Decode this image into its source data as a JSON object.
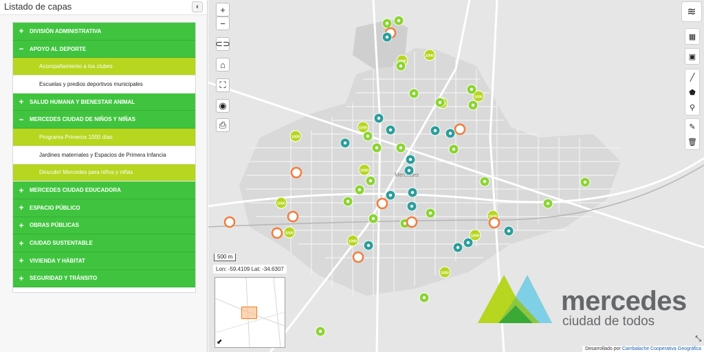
{
  "panel": {
    "title": "Listado de capas",
    "collapse_icon": "chevron-left-icon",
    "items": [
      {
        "kind": "group",
        "sign": "+",
        "label": "DIVISIÓN ADMINISTRATIVA"
      },
      {
        "kind": "group",
        "sign": "−",
        "label": "APOYO AL DEPORTE"
      },
      {
        "kind": "sub",
        "active": true,
        "label": "Acompañamiento a los clubes"
      },
      {
        "kind": "sub",
        "active": false,
        "label": "Escuelas y predios deportivos municipales"
      },
      {
        "kind": "group",
        "sign": "+",
        "label": "SALUD HUMANA Y BIENESTAR ANIMAL"
      },
      {
        "kind": "group",
        "sign": "−",
        "label": "MERCEDES CIUDAD DE NIÑOS Y NIÑAS"
      },
      {
        "kind": "sub",
        "active": true,
        "label": "Programa Primeros 1000 días"
      },
      {
        "kind": "sub",
        "active": false,
        "label": "Jardines maternales y Espacios de Primera Infancia"
      },
      {
        "kind": "sub",
        "active": true,
        "label": "Descubrí Mercedes para niños y niñas"
      },
      {
        "kind": "group",
        "sign": "+",
        "label": "MERCEDES CIUDAD EDUCADORA"
      },
      {
        "kind": "group",
        "sign": "+",
        "label": "ESPACIO PÚBLICO"
      },
      {
        "kind": "group",
        "sign": "+",
        "label": "OBRAS PÚBLICAS"
      },
      {
        "kind": "group",
        "sign": "+",
        "label": "CIUDAD SUSTENTABLE"
      },
      {
        "kind": "group",
        "sign": "+",
        "label": "VIVIENDA Y HÁBITAT"
      },
      {
        "kind": "group",
        "sign": "+",
        "label": "SEGURIDAD Y TRÁNSITO"
      }
    ]
  },
  "map": {
    "zoom_in": "+",
    "zoom_out": "−",
    "scale_label": "500 m",
    "coords": "Lon: -59.4109 Lat: -34.6307",
    "town_label": "Mercedes",
    "attribution_prefix": "Desarrollado por ",
    "attribution_link": "Cambalache Cooperativa Geográfica",
    "marker_1000": "1000",
    "logo_line1": "mercedes",
    "logo_line2": "ciudad de todos",
    "colors": {
      "group_green": "#40c43f",
      "sub_active": "#b6d61f",
      "marker_green": "#8bd432",
      "marker_orange": "#f27c3a",
      "marker_teal": "#2c9e9b",
      "logo_grey": "#65686b"
    }
  }
}
